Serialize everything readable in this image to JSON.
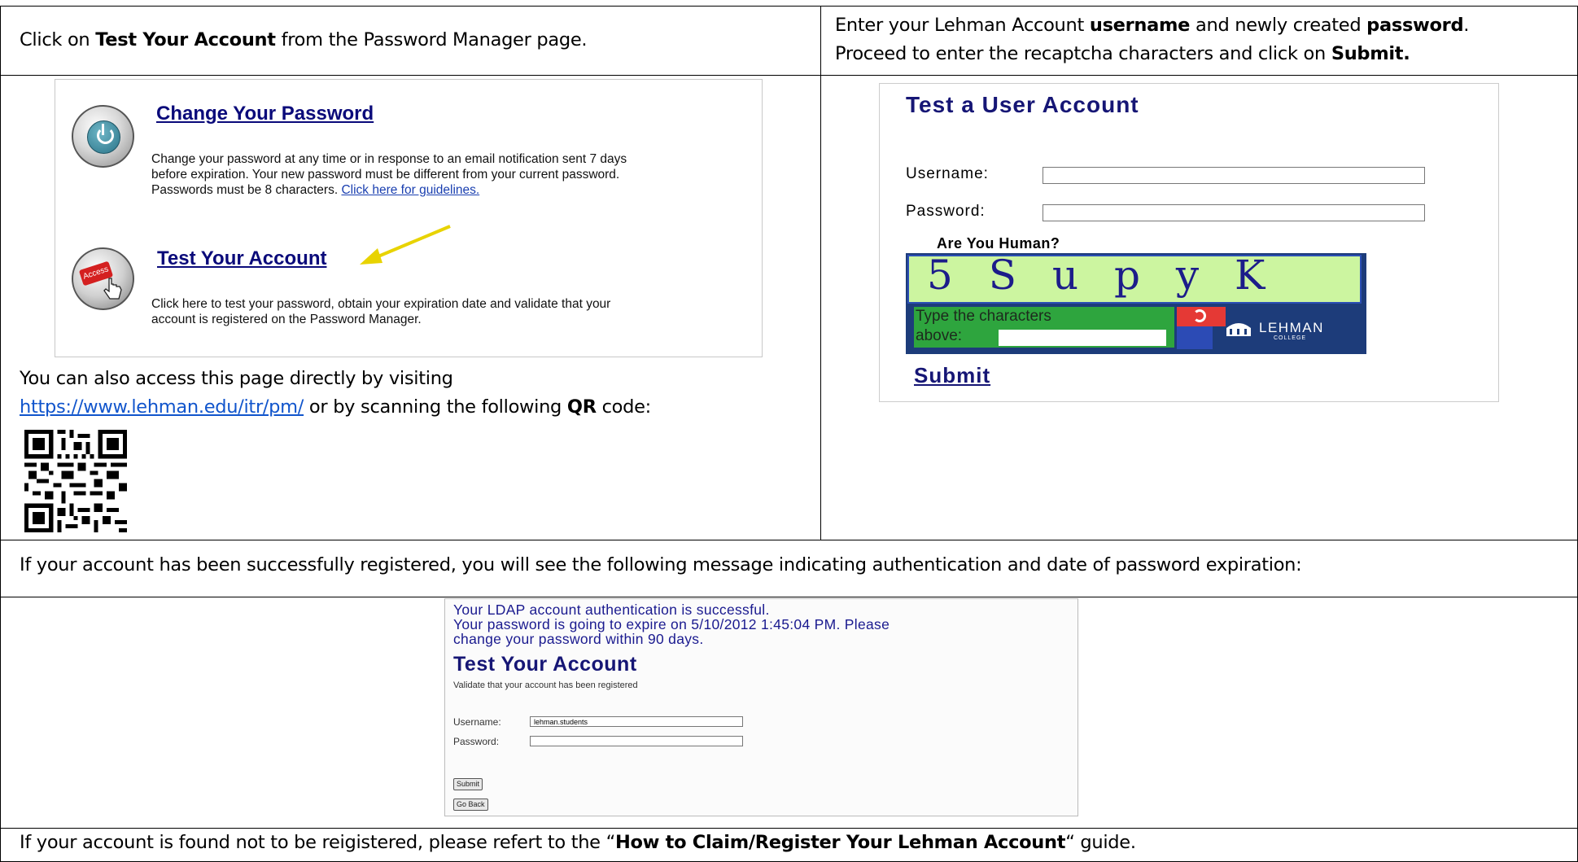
{
  "row1": {
    "left_text_pre": "Click on ",
    "left_text_bold": "Test Your Account",
    "left_text_post": " from the Password Manager page.",
    "right_line1_pre": "Enter your Lehman Account ",
    "right_line1_bold1": "username",
    "right_line1_mid": " and newly created ",
    "right_line1_bold2": "password",
    "right_line1_end": ".",
    "right_line2_pre": "Proceed to enter the recaptcha characters and click on ",
    "right_line2_bold": "Submit."
  },
  "pm_shot": {
    "change_title": "Change Your Password",
    "change_desc_1": "Change your password at any time or in response to an email notification sent 7 days",
    "change_desc_2": "before expiration. Your new password must be different from your current password.",
    "change_desc_3": "Passwords must be 8 characters. ",
    "change_link": "Click here for guidelines.",
    "test_title": "Test Your Account",
    "test_desc_1": "Click here to test your password, obtain your expiration date and validate that your",
    "test_desc_2": "account is registered on the Password Manager.",
    "access_label": "Access"
  },
  "row2_left": {
    "line1": "You can also access this page directly by visiting",
    "url": "https://www.lehman.edu/itr/pm/",
    "line2_mid": " or by scanning the following ",
    "line2_bold": "QR",
    "line2_end": " code:"
  },
  "test_shot": {
    "title": "Test a User Account",
    "username_label": "Username:",
    "password_label": "Password:",
    "human_label": "Are You Human?",
    "captcha_text": "5 S u p y K",
    "type_label_1": "Type the characters",
    "type_label_2": "above:",
    "brand": "LEHMAN",
    "brand_sub": "COLLEGE",
    "submit": "Submit"
  },
  "row3": {
    "text": "If your account has been successfully registered, you will see the following message indicating authentication and date of password expiration:"
  },
  "result_shot": {
    "msg1": "Your LDAP account authentication is successful.",
    "msg2": "Your password is going to expire on 5/10/2012 1:45:04 PM. Please",
    "msg3": "change your password within 90 days.",
    "title": "Test Your Account",
    "subtitle": "Validate that your account has been registered",
    "username_label": "Username:",
    "username_value": "lehman.students",
    "password_label": "Password:",
    "submit": "Submit",
    "goback": "Go Back"
  },
  "row5": {
    "pre": "If your account is found not to be reigistered, please refert to the “",
    "bold": "How to Claim/Register Your Lehman Account",
    "post": "“ guide."
  }
}
